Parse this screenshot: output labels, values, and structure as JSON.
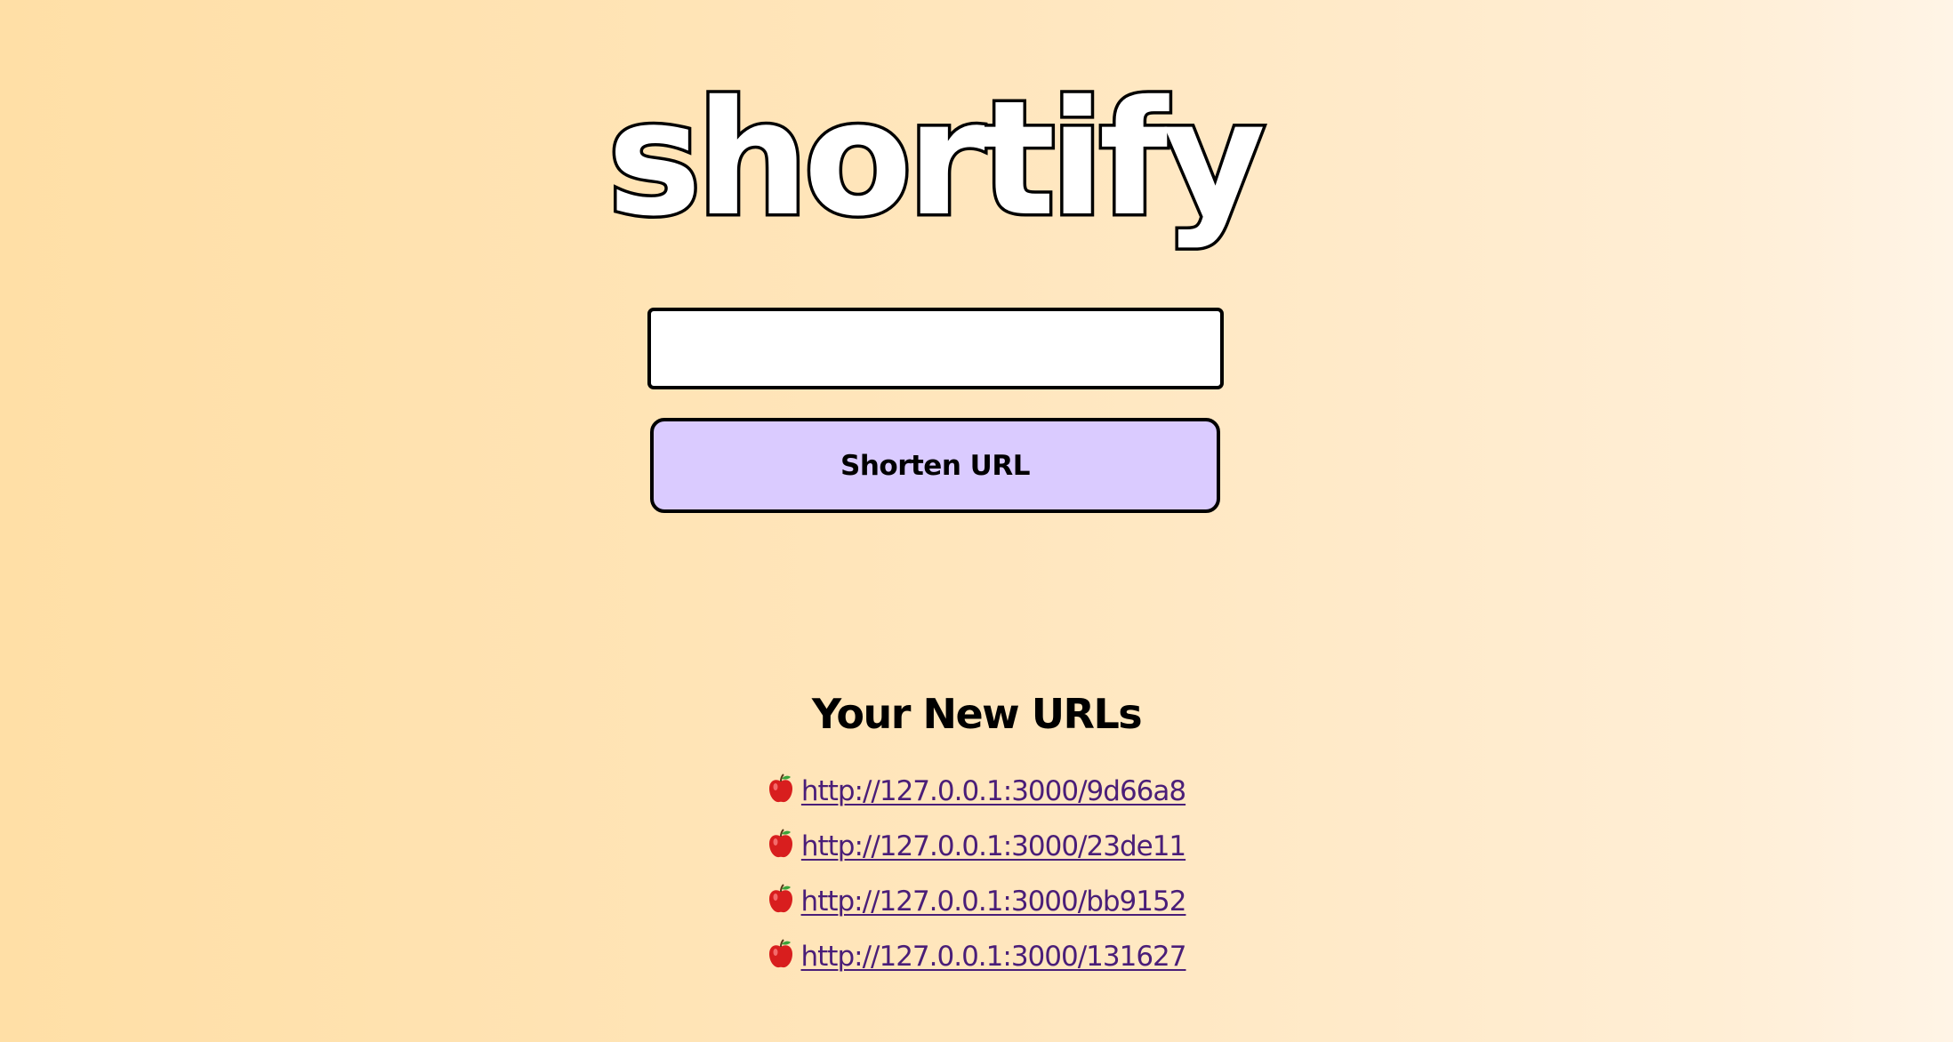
{
  "logo": {
    "text": "shortify"
  },
  "form": {
    "input_value": "",
    "input_placeholder": "",
    "button_label": "Shorten URL"
  },
  "results": {
    "heading": "Your New URLs",
    "item_icon": "apple-icon",
    "urls": [
      "http://127.0.0.1:3000/9d66a8",
      "http://127.0.0.1:3000/23de11",
      "http://127.0.0.1:3000/bb9152",
      "http://127.0.0.1:3000/131627"
    ]
  },
  "colors": {
    "background_start": "#ffdfa6",
    "background_end": "#fff4e6",
    "button_fill": "#dacbff",
    "link": "#4a1e78",
    "border": "#000000"
  }
}
